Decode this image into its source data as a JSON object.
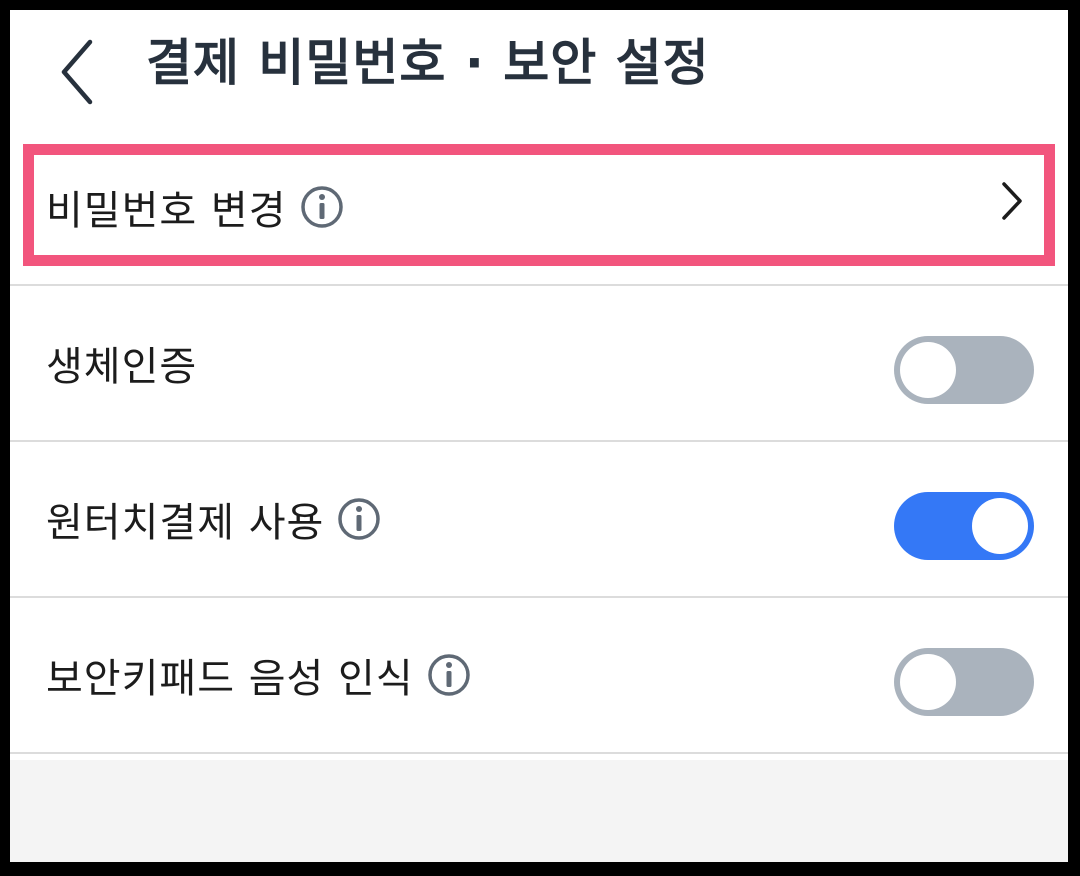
{
  "header": {
    "title": "결제 비밀번호 · 보안 설정",
    "back_icon": "chevron-left-icon"
  },
  "rows": [
    {
      "label": "비밀번호 변경",
      "has_info": true,
      "control": "chevron",
      "highlighted": true
    },
    {
      "label": "생체인증",
      "has_info": false,
      "control": "toggle",
      "on": false
    },
    {
      "label": "원터치결제 사용",
      "has_info": true,
      "control": "toggle",
      "on": true
    },
    {
      "label": "보안키패드 음성 인식",
      "has_info": true,
      "control": "toggle",
      "on": false
    }
  ],
  "colors": {
    "title_text": "#27313d",
    "label_text": "#1c1c1c",
    "highlight_border": "#f2557d",
    "toggle_on": "#3478f6",
    "toggle_off": "#aab3bd",
    "info_icon": "#5f6975",
    "divider": "#dcdcdc",
    "footer_bg": "#f4f4f4"
  }
}
